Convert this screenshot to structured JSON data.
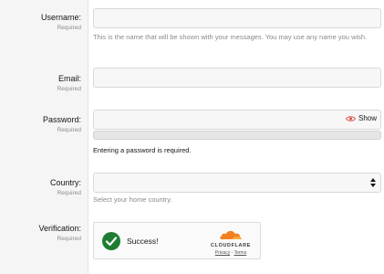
{
  "form": {
    "username": {
      "label": "Username:",
      "required": "Required",
      "value": "",
      "hint": "This is the name that will be shown with your messages. You may use any name you wish."
    },
    "email": {
      "label": "Email:",
      "required": "Required",
      "value": ""
    },
    "password": {
      "label": "Password:",
      "required": "Required",
      "value": "",
      "show_label": "Show",
      "strength_fraction": 0,
      "message": "Entering a password is required."
    },
    "country": {
      "label": "Country:",
      "required": "Required",
      "selected": "",
      "hint": "Select your home country."
    },
    "verification": {
      "label": "Verification:",
      "required": "Required",
      "status": "Success!",
      "brand": "CLOUDFLARE",
      "privacy": "Privacy",
      "separator": "-",
      "terms": "Terms"
    }
  },
  "colors": {
    "success_green": "#1e7d32",
    "eye_red": "#d9534f",
    "cloudflare_orange": "#f38020"
  },
  "icons": {
    "eye": "eye-icon",
    "check": "success-check-icon",
    "select": "select-arrows-icon",
    "cloud": "cloudflare-cloud-icon"
  }
}
